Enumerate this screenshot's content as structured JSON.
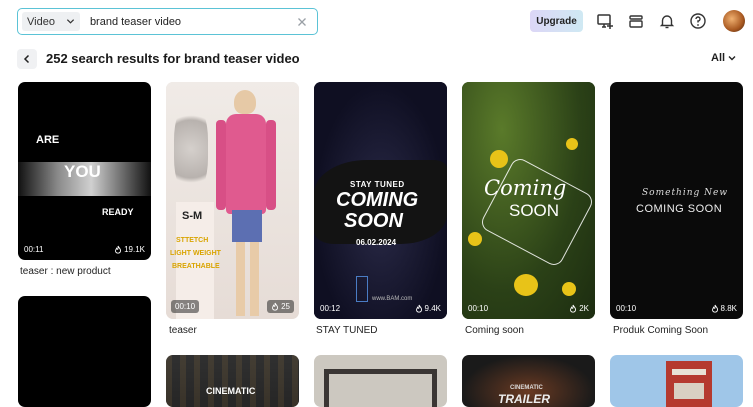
{
  "search": {
    "type_label": "Video",
    "query": "brand teaser video"
  },
  "header": {
    "upgrade_label": "Upgrade"
  },
  "results": {
    "title": "252 search results for brand teaser video",
    "filter_label": "All"
  },
  "cards": [
    {
      "duration": "00:11",
      "likes": "19.1K",
      "caption": "teaser : new product",
      "overlay": {
        "line1": "ARE",
        "line2": "YOU",
        "line3": "READY"
      }
    },
    {
      "duration": "00:10",
      "likes": "25",
      "caption": "teaser",
      "overlay": {
        "size": "S-M",
        "line1": "STTETCH",
        "line2": "LIGHT WEIGHT",
        "line3": "BREATHABLE"
      }
    },
    {
      "duration": "00:12",
      "likes": "9.4K",
      "caption": "STAY TUNED",
      "overlay": {
        "line1": "STAY TUNED",
        "line2": "COMING",
        "line3": "SOON",
        "date": "06.02.2024",
        "site": "www.BAM.com"
      }
    },
    {
      "duration": "00:10",
      "likes": "2K",
      "caption": "Coming soon",
      "overlay": {
        "line1": "Coming",
        "line2": "SOON"
      }
    },
    {
      "duration": "00:10",
      "likes": "8.8K",
      "caption": "Produk Coming Soon",
      "overlay": {
        "line1": "Something New",
        "line2": "COMING SOON"
      }
    }
  ],
  "row2": {
    "card2_text": "CINEMATIC",
    "card4_text1": "CINEMATIC",
    "card4_text2": "TRAILER"
  },
  "colors": {
    "accent_border": "#5bc3d6",
    "upgrade_gradient_start": "#dcd6f6",
    "upgrade_gradient_end": "#cfe9f3"
  },
  "icons": [
    "chevron-down-icon",
    "clear-icon",
    "add-to-screen-icon",
    "layers-icon",
    "bell-icon",
    "help-icon",
    "back-icon",
    "flame-icon"
  ]
}
